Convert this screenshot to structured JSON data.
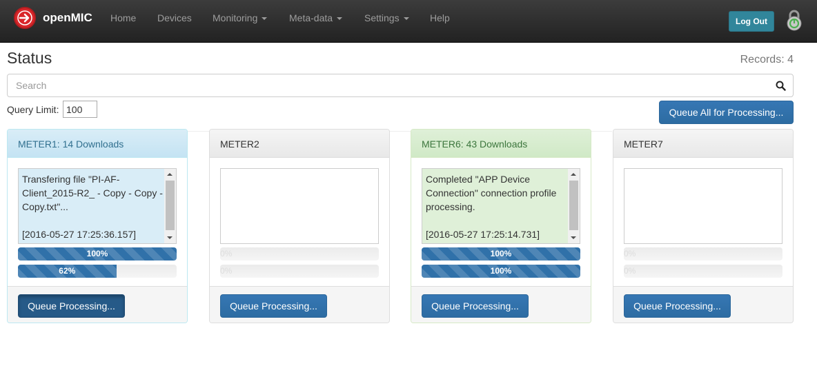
{
  "nav": {
    "brand": "openMIC",
    "items": [
      "Home",
      "Devices",
      "Monitoring",
      "Meta-data",
      "Settings",
      "Help"
    ],
    "logout": "Log Out"
  },
  "page": {
    "title": "Status",
    "records": "Records: 4",
    "search_placeholder": "Search",
    "query_limit_label": "Query Limit:",
    "query_limit_value": "100",
    "queue_all": "Queue All for Processing..."
  },
  "colors": {
    "info_heading": "#d9edf7",
    "success_heading": "#dff0d8",
    "primary_button": "#337ab7",
    "logout_button": "#31869b"
  },
  "meters": [
    {
      "heading": "METER1: 14 Downloads",
      "state": "info",
      "message": "Transfering file \"PI-AF-Client_2015-R2_ - Copy - Copy - Copy.txt\"...\n\n[2016-05-27 17:25:36.157]",
      "progress1": {
        "value": 1.0,
        "label": "100%"
      },
      "progress2": {
        "value": 0.62,
        "label": "62%"
      },
      "queue_button": "Queue Processing..."
    },
    {
      "heading": "METER2",
      "state": "default",
      "message": "",
      "progress1": {
        "value": 0,
        "label": "0%"
      },
      "progress2": {
        "value": 0,
        "label": "0%"
      },
      "queue_button": "Queue Processing..."
    },
    {
      "heading": "METER6: 43 Downloads",
      "state": "success",
      "message": "Completed \"APP Device Connection\" connection profile processing.\n\n[2016-05-27 17:25:14.731]",
      "progress1": {
        "value": 1.0,
        "label": "100%"
      },
      "progress2": {
        "value": 1.0,
        "label": "100%"
      },
      "queue_button": "Queue Processing..."
    },
    {
      "heading": "METER7",
      "state": "default",
      "message": "",
      "progress1": {
        "value": 0,
        "label": "0%"
      },
      "progress2": {
        "value": 0,
        "label": "0%"
      },
      "queue_button": "Queue Processing..."
    }
  ]
}
